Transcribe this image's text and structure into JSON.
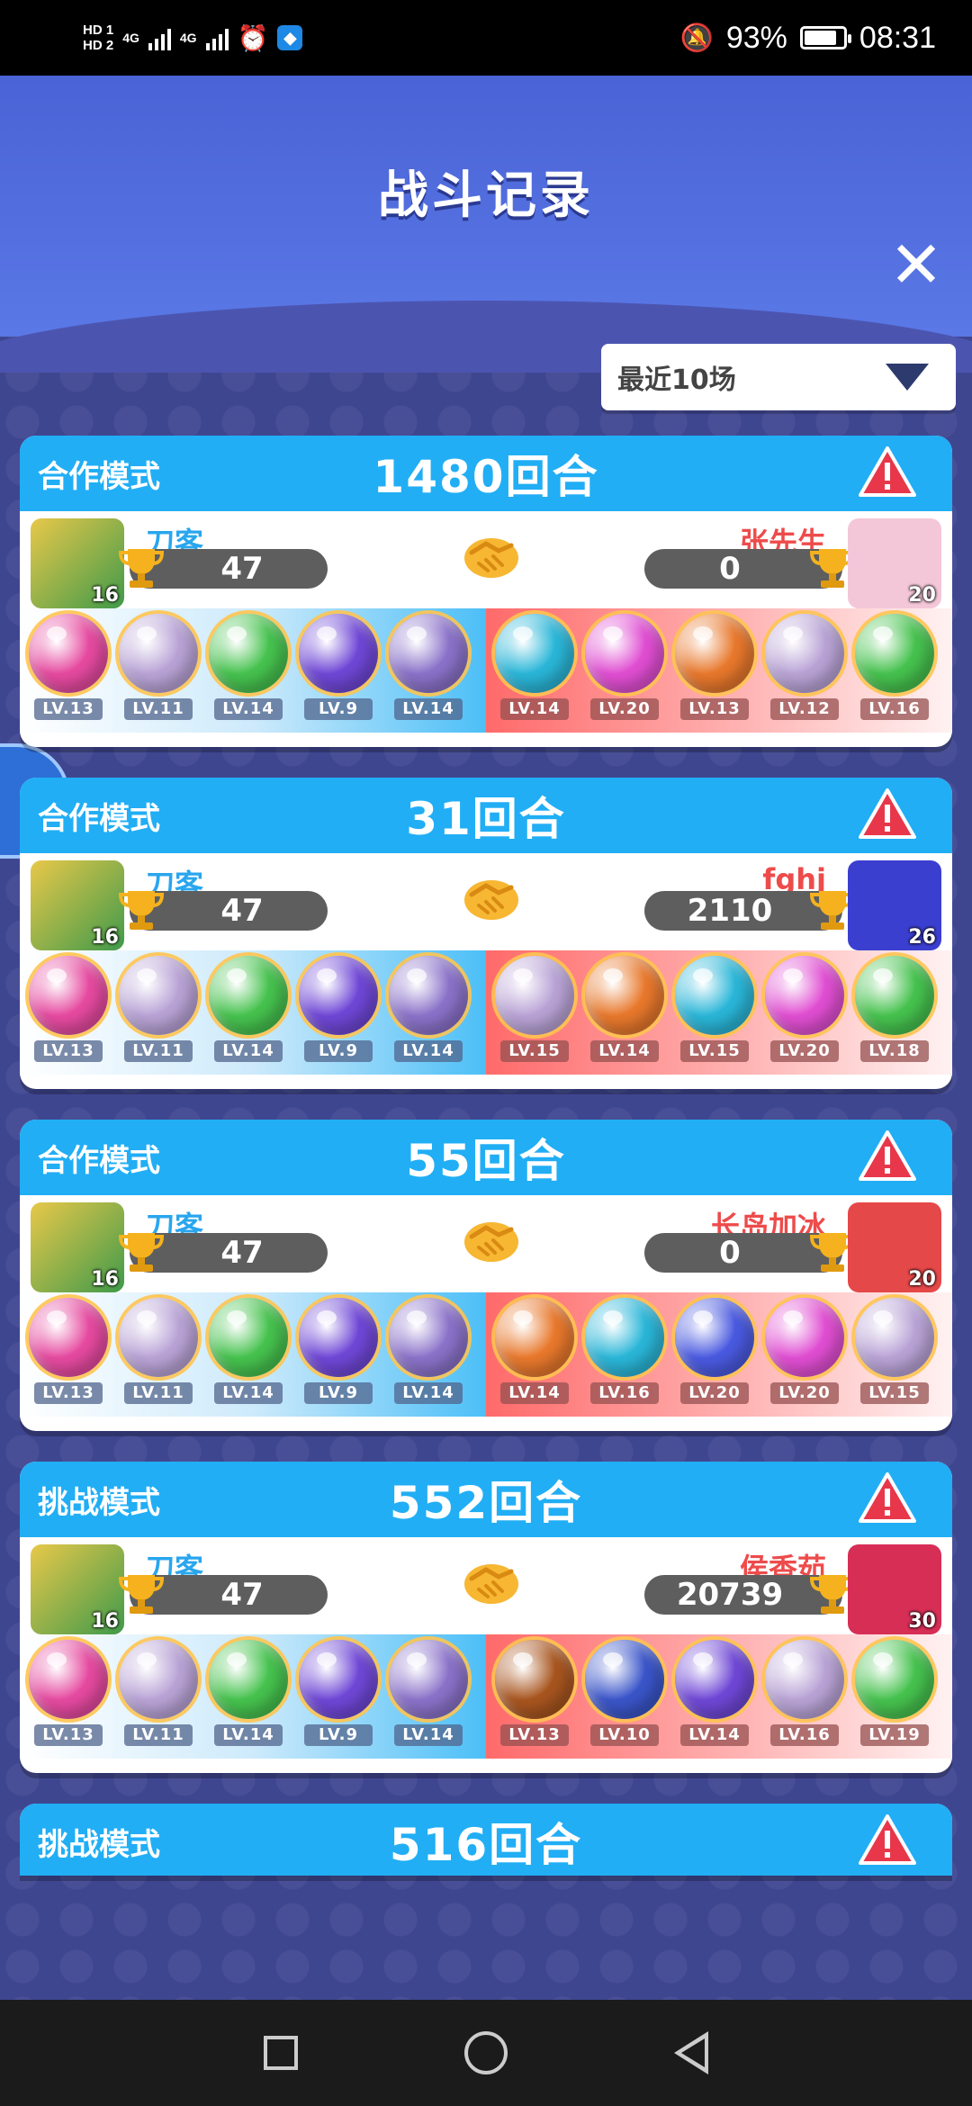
{
  "status_bar": {
    "hd_top": "HD 1",
    "hd_bottom": "HD 2",
    "net1": "4G",
    "net2": "4G",
    "battery": "93%",
    "battery_level": 0.93,
    "time": "08:31"
  },
  "header": {
    "title": "战斗记录",
    "close_icon": "close-icon"
  },
  "filter": {
    "selected": "最近10场",
    "icon": "dropdown-triangle-icon"
  },
  "player": {
    "name": "刀客",
    "score": "47",
    "level": "16",
    "orbs": [
      {
        "color": "#e64aa0",
        "lv": "LV.13"
      },
      {
        "color": "#b9a3d6",
        "lv": "LV.11"
      },
      {
        "color": "#46c24e",
        "lv": "LV.14"
      },
      {
        "color": "#6f47d6",
        "lv": "LV.9"
      },
      {
        "color": "#8a72c9",
        "lv": "LV.14"
      }
    ]
  },
  "records": [
    {
      "mode": "合作模式",
      "rounds": "1480回合",
      "opponent": "张先生",
      "opp_score": "0",
      "opp_level": "20",
      "opp_avatar_color": "#f4c7d8",
      "opp_orbs": [
        {
          "color": "#2ab6d8",
          "lv": "LV.14"
        },
        {
          "color": "#e04ed2",
          "lv": "LV.20"
        },
        {
          "color": "#e8782c",
          "lv": "LV.13"
        },
        {
          "color": "#b9a3d6",
          "lv": "LV.12"
        },
        {
          "color": "#46c24e",
          "lv": "LV.16"
        }
      ]
    },
    {
      "mode": "合作模式",
      "rounds": "31回合",
      "opponent": "fghj",
      "opp_score": "2110",
      "opp_level": "26",
      "opp_avatar_color": "#3b3fd0",
      "opp_orbs": [
        {
          "color": "#b9a3d6",
          "lv": "LV.15"
        },
        {
          "color": "#e8782c",
          "lv": "LV.14"
        },
        {
          "color": "#2ab6d8",
          "lv": "LV.15"
        },
        {
          "color": "#e04ed2",
          "lv": "LV.20"
        },
        {
          "color": "#46c24e",
          "lv": "LV.18"
        }
      ]
    },
    {
      "mode": "合作模式",
      "rounds": "55回合",
      "opponent": "长岛加冰",
      "opp_score": "0",
      "opp_level": "20",
      "opp_avatar_color": "#e54848",
      "opp_orbs": [
        {
          "color": "#e8782c",
          "lv": "LV.14"
        },
        {
          "color": "#2ab6d8",
          "lv": "LV.16"
        },
        {
          "color": "#4a5ae0",
          "lv": "LV.20"
        },
        {
          "color": "#e04ed2",
          "lv": "LV.20"
        },
        {
          "color": "#b9a3d6",
          "lv": "LV.15"
        }
      ]
    },
    {
      "mode": "挑战模式",
      "rounds": "552回合",
      "opponent": "侯香茹",
      "opp_score": "20739",
      "opp_level": "30",
      "opp_avatar_color": "#d72e56",
      "opp_orbs": [
        {
          "color": "#a8551f",
          "lv": "LV.13"
        },
        {
          "color": "#3a55c9",
          "lv": "LV.10"
        },
        {
          "color": "#6f47d6",
          "lv": "LV.14"
        },
        {
          "color": "#b9a3d6",
          "lv": "LV.16"
        },
        {
          "color": "#46c24e",
          "lv": "LV.19"
        }
      ]
    }
  ],
  "partial_record": {
    "mode": "挑战模式",
    "rounds": "516回合"
  }
}
